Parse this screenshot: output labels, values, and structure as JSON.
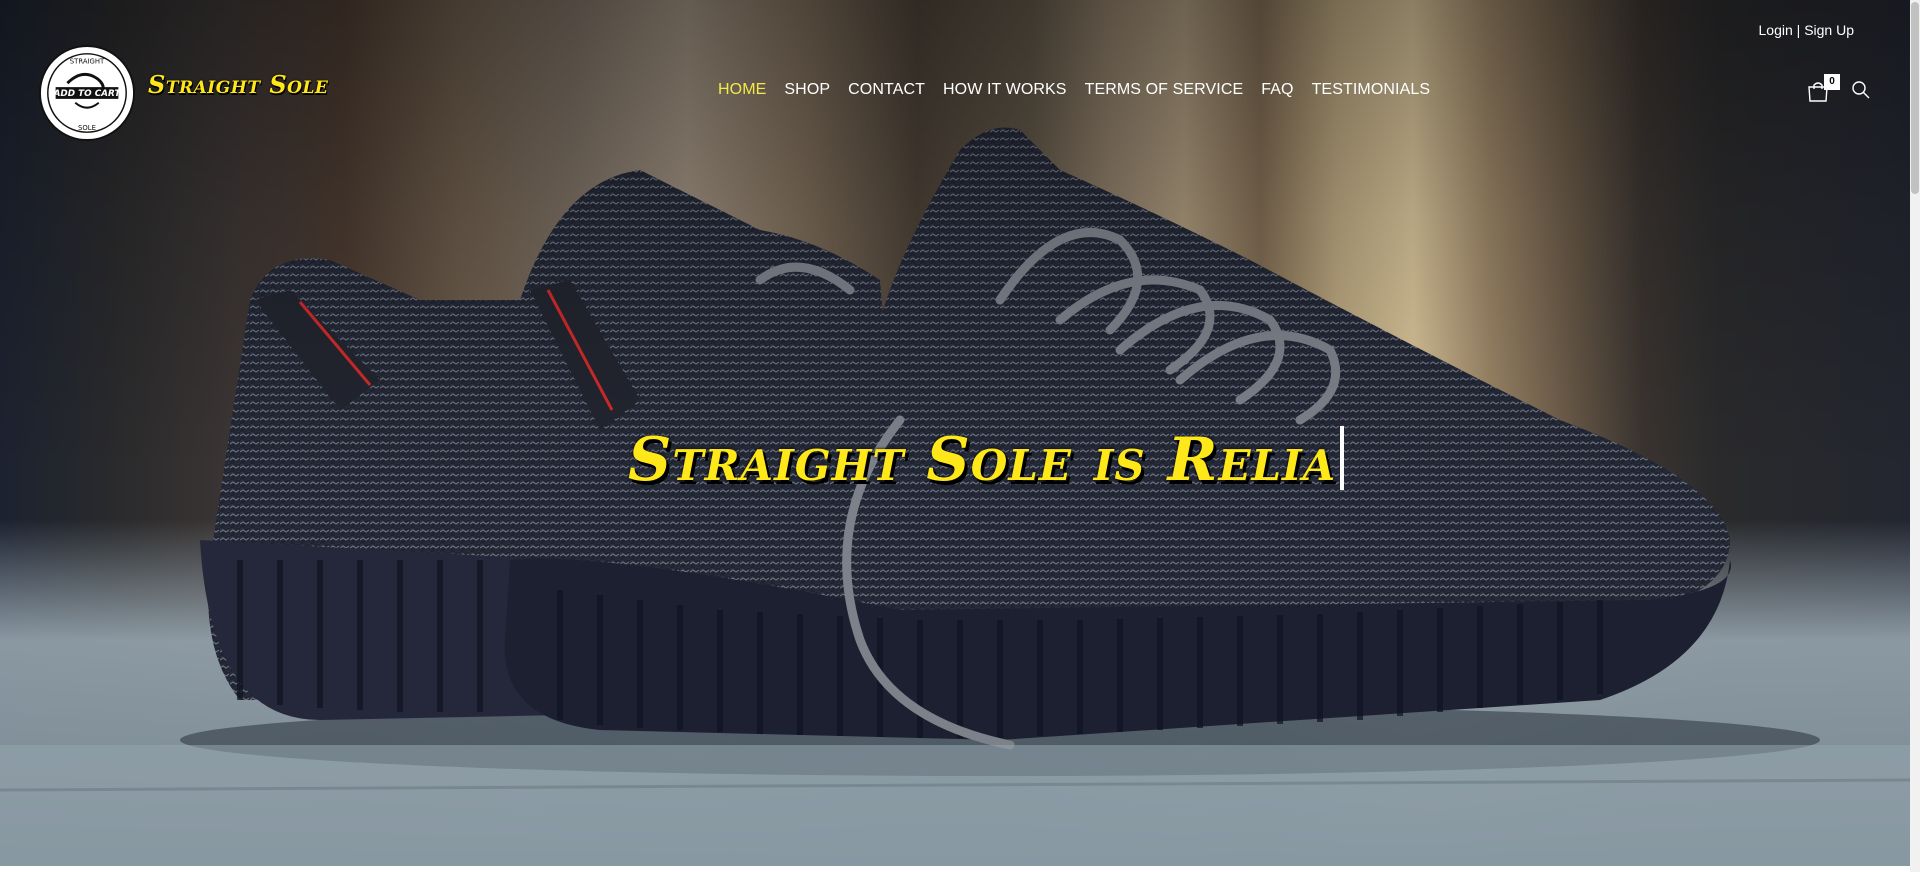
{
  "header": {
    "login_label": "Login",
    "separator": "|",
    "signup_label": "Sign Up",
    "brand_name": "Straight Sole",
    "logo_text": {
      "top": "STRAIGHT",
      "middle": "ADD TO CART",
      "bottom": "SOLE"
    },
    "cart_count": "0"
  },
  "nav": {
    "items": [
      {
        "label": "HOME",
        "active": true
      },
      {
        "label": "SHOP",
        "active": false
      },
      {
        "label": "CONTACT",
        "active": false
      },
      {
        "label": "HOW IT WORKS",
        "active": false
      },
      {
        "label": "TERMS OF SERVICE",
        "active": false
      },
      {
        "label": "FAQ",
        "active": false
      },
      {
        "label": "TESTIMONIALS",
        "active": false
      }
    ]
  },
  "hero": {
    "headline": "Straight Sole is Relia"
  },
  "icons": {
    "cart": "shopping-bag-icon",
    "search": "search-icon"
  },
  "colors": {
    "brand_yellow": "#ffe81a",
    "nav_active": "#f5e94a",
    "nav_text": "#ffffff"
  }
}
